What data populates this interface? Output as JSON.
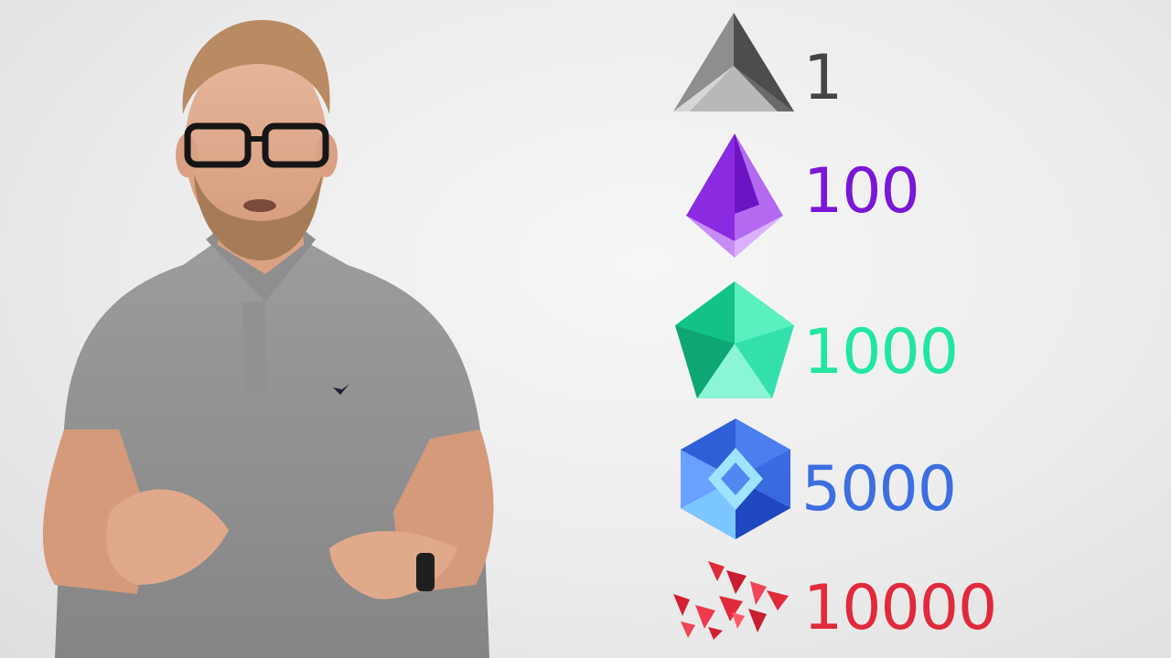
{
  "tiers": [
    {
      "label": "1",
      "color": "#444444",
      "icon": "gray-crystal-icon"
    },
    {
      "label": "100",
      "color": "#7a17d6",
      "icon": "purple-crystal-icon"
    },
    {
      "label": "1000",
      "color": "#22e6a0",
      "icon": "green-gem-icon"
    },
    {
      "label": "5000",
      "color": "#3d6ee0",
      "icon": "blue-gem-icon"
    },
    {
      "label": "10000",
      "color": "#e02a3c",
      "icon": "red-shards-icon"
    }
  ]
}
